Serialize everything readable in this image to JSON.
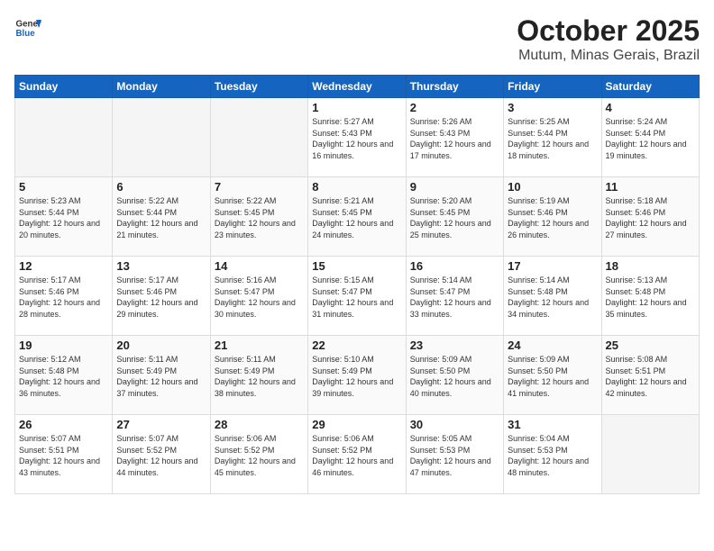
{
  "header": {
    "logo": {
      "general": "General",
      "blue": "Blue"
    },
    "title": "October 2025",
    "location": "Mutum, Minas Gerais, Brazil"
  },
  "calendar": {
    "weekdays": [
      "Sunday",
      "Monday",
      "Tuesday",
      "Wednesday",
      "Thursday",
      "Friday",
      "Saturday"
    ],
    "weeks": [
      [
        {
          "day": "",
          "info": ""
        },
        {
          "day": "",
          "info": ""
        },
        {
          "day": "",
          "info": ""
        },
        {
          "day": "1",
          "info": "Sunrise: 5:27 AM\nSunset: 5:43 PM\nDaylight: 12 hours and 16 minutes."
        },
        {
          "day": "2",
          "info": "Sunrise: 5:26 AM\nSunset: 5:43 PM\nDaylight: 12 hours and 17 minutes."
        },
        {
          "day": "3",
          "info": "Sunrise: 5:25 AM\nSunset: 5:44 PM\nDaylight: 12 hours and 18 minutes."
        },
        {
          "day": "4",
          "info": "Sunrise: 5:24 AM\nSunset: 5:44 PM\nDaylight: 12 hours and 19 minutes."
        }
      ],
      [
        {
          "day": "5",
          "info": "Sunrise: 5:23 AM\nSunset: 5:44 PM\nDaylight: 12 hours and 20 minutes."
        },
        {
          "day": "6",
          "info": "Sunrise: 5:22 AM\nSunset: 5:44 PM\nDaylight: 12 hours and 21 minutes."
        },
        {
          "day": "7",
          "info": "Sunrise: 5:22 AM\nSunset: 5:45 PM\nDaylight: 12 hours and 23 minutes."
        },
        {
          "day": "8",
          "info": "Sunrise: 5:21 AM\nSunset: 5:45 PM\nDaylight: 12 hours and 24 minutes."
        },
        {
          "day": "9",
          "info": "Sunrise: 5:20 AM\nSunset: 5:45 PM\nDaylight: 12 hours and 25 minutes."
        },
        {
          "day": "10",
          "info": "Sunrise: 5:19 AM\nSunset: 5:46 PM\nDaylight: 12 hours and 26 minutes."
        },
        {
          "day": "11",
          "info": "Sunrise: 5:18 AM\nSunset: 5:46 PM\nDaylight: 12 hours and 27 minutes."
        }
      ],
      [
        {
          "day": "12",
          "info": "Sunrise: 5:17 AM\nSunset: 5:46 PM\nDaylight: 12 hours and 28 minutes."
        },
        {
          "day": "13",
          "info": "Sunrise: 5:17 AM\nSunset: 5:46 PM\nDaylight: 12 hours and 29 minutes."
        },
        {
          "day": "14",
          "info": "Sunrise: 5:16 AM\nSunset: 5:47 PM\nDaylight: 12 hours and 30 minutes."
        },
        {
          "day": "15",
          "info": "Sunrise: 5:15 AM\nSunset: 5:47 PM\nDaylight: 12 hours and 31 minutes."
        },
        {
          "day": "16",
          "info": "Sunrise: 5:14 AM\nSunset: 5:47 PM\nDaylight: 12 hours and 33 minutes."
        },
        {
          "day": "17",
          "info": "Sunrise: 5:14 AM\nSunset: 5:48 PM\nDaylight: 12 hours and 34 minutes."
        },
        {
          "day": "18",
          "info": "Sunrise: 5:13 AM\nSunset: 5:48 PM\nDaylight: 12 hours and 35 minutes."
        }
      ],
      [
        {
          "day": "19",
          "info": "Sunrise: 5:12 AM\nSunset: 5:48 PM\nDaylight: 12 hours and 36 minutes."
        },
        {
          "day": "20",
          "info": "Sunrise: 5:11 AM\nSunset: 5:49 PM\nDaylight: 12 hours and 37 minutes."
        },
        {
          "day": "21",
          "info": "Sunrise: 5:11 AM\nSunset: 5:49 PM\nDaylight: 12 hours and 38 minutes."
        },
        {
          "day": "22",
          "info": "Sunrise: 5:10 AM\nSunset: 5:49 PM\nDaylight: 12 hours and 39 minutes."
        },
        {
          "day": "23",
          "info": "Sunrise: 5:09 AM\nSunset: 5:50 PM\nDaylight: 12 hours and 40 minutes."
        },
        {
          "day": "24",
          "info": "Sunrise: 5:09 AM\nSunset: 5:50 PM\nDaylight: 12 hours and 41 minutes."
        },
        {
          "day": "25",
          "info": "Sunrise: 5:08 AM\nSunset: 5:51 PM\nDaylight: 12 hours and 42 minutes."
        }
      ],
      [
        {
          "day": "26",
          "info": "Sunrise: 5:07 AM\nSunset: 5:51 PM\nDaylight: 12 hours and 43 minutes."
        },
        {
          "day": "27",
          "info": "Sunrise: 5:07 AM\nSunset: 5:52 PM\nDaylight: 12 hours and 44 minutes."
        },
        {
          "day": "28",
          "info": "Sunrise: 5:06 AM\nSunset: 5:52 PM\nDaylight: 12 hours and 45 minutes."
        },
        {
          "day": "29",
          "info": "Sunrise: 5:06 AM\nSunset: 5:52 PM\nDaylight: 12 hours and 46 minutes."
        },
        {
          "day": "30",
          "info": "Sunrise: 5:05 AM\nSunset: 5:53 PM\nDaylight: 12 hours and 47 minutes."
        },
        {
          "day": "31",
          "info": "Sunrise: 5:04 AM\nSunset: 5:53 PM\nDaylight: 12 hours and 48 minutes."
        },
        {
          "day": "",
          "info": ""
        }
      ]
    ]
  }
}
